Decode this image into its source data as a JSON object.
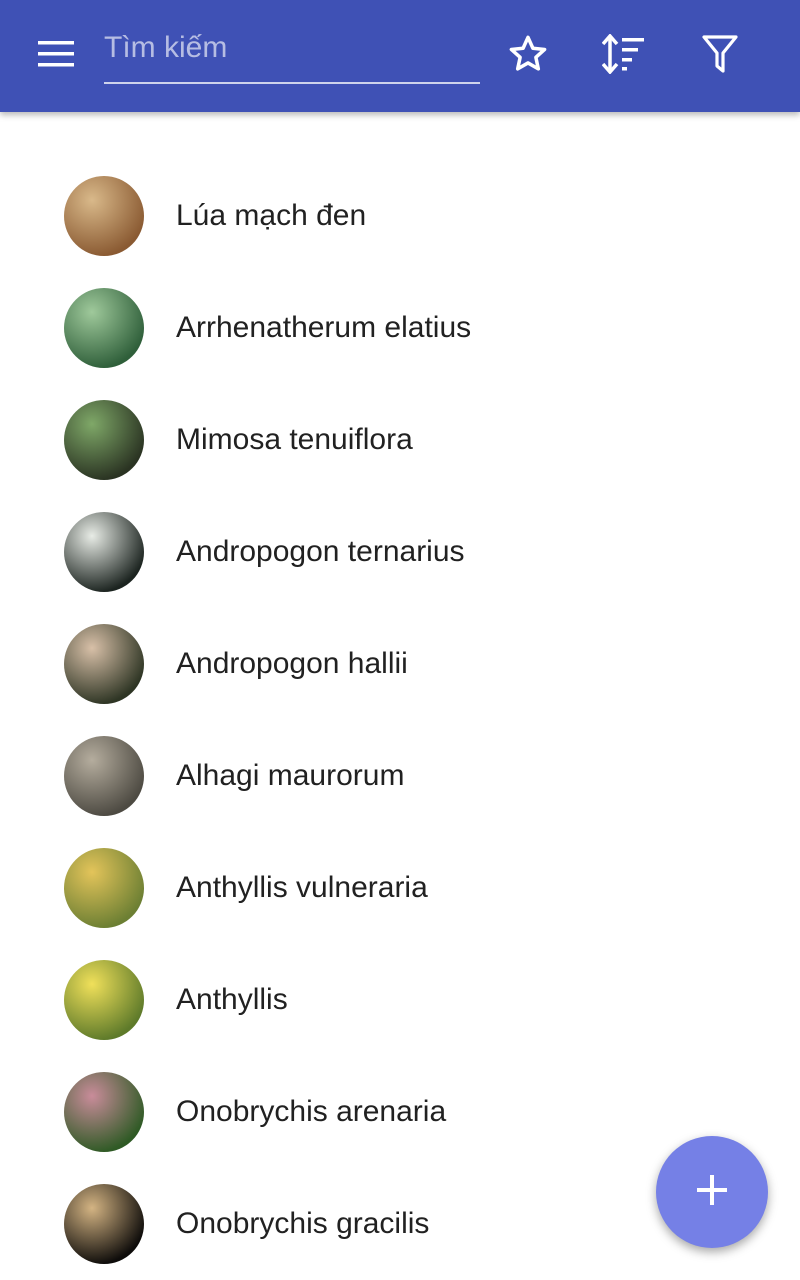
{
  "colors": {
    "app_bar": "#3f51b5",
    "fab": "#7580e6",
    "text_primary": "#212121"
  },
  "toolbar": {
    "menu_icon": "hamburger-menu-icon",
    "search": {
      "placeholder": "Tìm kiếm",
      "value": ""
    },
    "actions": [
      {
        "icon": "star-outline-icon"
      },
      {
        "icon": "sort-icon"
      },
      {
        "icon": "filter-icon"
      }
    ]
  },
  "list": {
    "items": [
      {
        "label": "Lúa mạch đen",
        "thumb_colors": [
          "#d9b98a",
          "#8a5a32"
        ]
      },
      {
        "label": "Arrhenatherum elatius",
        "thumb_colors": [
          "#9fc99b",
          "#2f5f3a"
        ]
      },
      {
        "label": "Mimosa tenuiflora",
        "thumb_colors": [
          "#7fa868",
          "#2a3322"
        ]
      },
      {
        "label": "Andropogon ternarius",
        "thumb_colors": [
          "#e8ece6",
          "#1c2420"
        ]
      },
      {
        "label": "Andropogon hallii",
        "thumb_colors": [
          "#d8c0a8",
          "#2e3524"
        ]
      },
      {
        "label": "Alhagi maurorum",
        "thumb_colors": [
          "#b5ad9e",
          "#4d4a42"
        ]
      },
      {
        "label": "Anthyllis vulneraria",
        "thumb_colors": [
          "#e3c45a",
          "#6c7f33"
        ]
      },
      {
        "label": "Anthyllis",
        "thumb_colors": [
          "#f0e05a",
          "#5e7a2a"
        ]
      },
      {
        "label": "Onobrychis arenaria",
        "thumb_colors": [
          "#c98c9a",
          "#2f5a25"
        ]
      },
      {
        "label": "Onobrychis gracilis",
        "thumb_colors": [
          "#d4b483",
          "#0e0c0a"
        ]
      }
    ]
  },
  "fab": {
    "icon": "plus-icon"
  }
}
